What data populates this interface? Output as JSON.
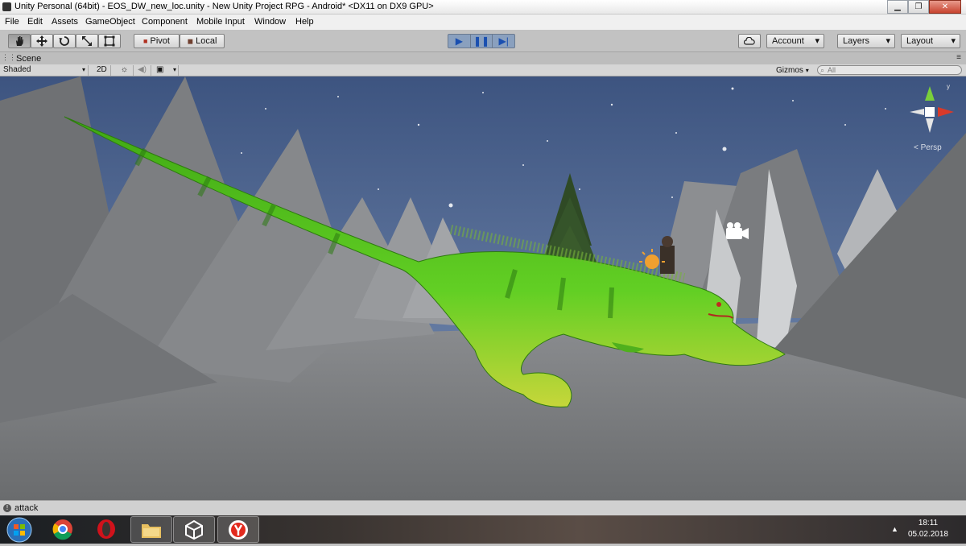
{
  "window": {
    "title": "Unity Personal (64bit) - EOS_DW_new_loc.unity - New Unity Project RPG - Android* <DX11 on DX9 GPU>",
    "buttons": {
      "minimize": "▁",
      "maximize": "❐",
      "close": "✕"
    }
  },
  "menu": [
    "File",
    "Edit",
    "Assets",
    "GameObject",
    "Component",
    "Mobile Input",
    "Window",
    "Help"
  ],
  "toolbar": {
    "pivot": "Pivot",
    "local": "Local",
    "account": "Account",
    "layers": "Layers",
    "layout": "Layout",
    "dropdown_arrow": "▾"
  },
  "scene": {
    "tab_label": "Scene",
    "shading": "Shaded",
    "mode_2d": "2D",
    "gizmos": "Gizmos",
    "search_placeholder": "All",
    "persp_label": "Persp"
  },
  "status": {
    "message": "attack"
  },
  "taskbar": {
    "time": "18:11",
    "date": "05.02.2018"
  },
  "colors": {
    "sky": "#5a7099",
    "ground": "#767676",
    "dino": "#4fbf1f",
    "accent_play": "#1a4fb0"
  }
}
